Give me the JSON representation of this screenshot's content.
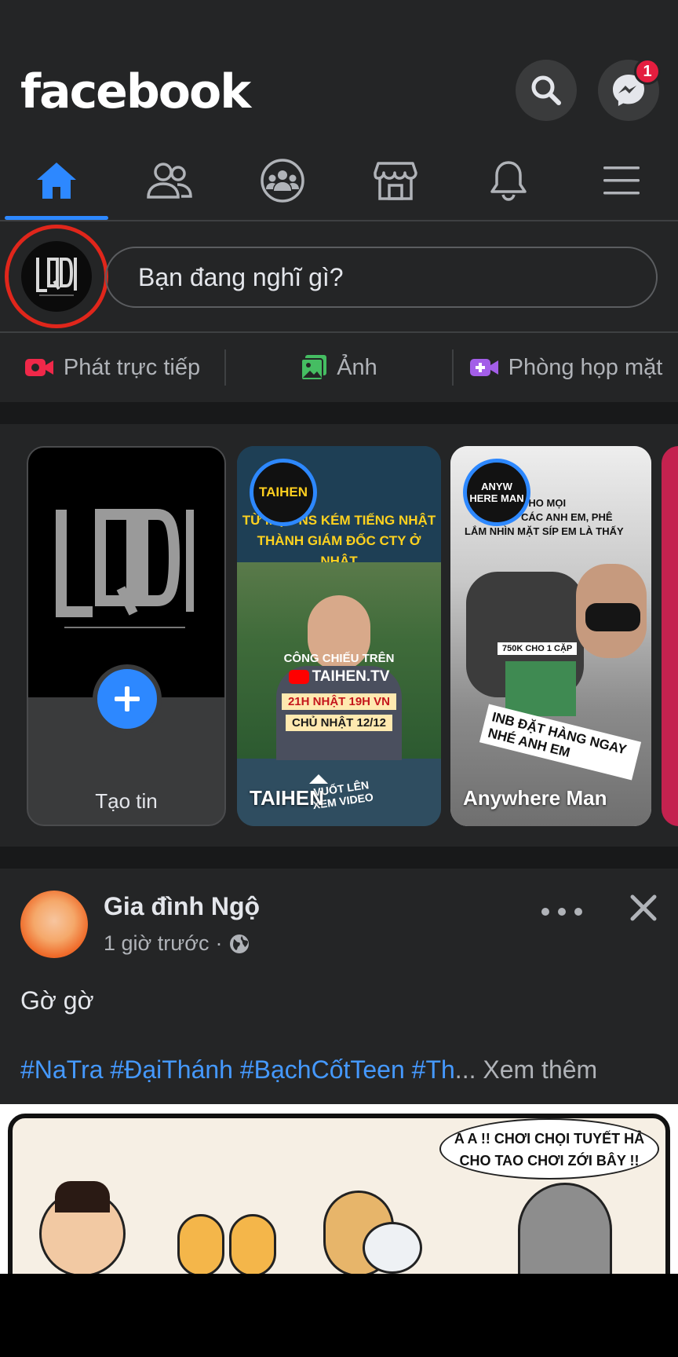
{
  "header": {
    "logo": "facebook",
    "search_icon": "search-icon",
    "messenger_icon": "messenger-icon",
    "messenger_badge": "1"
  },
  "tabs": [
    {
      "name": "home",
      "icon": "home-icon",
      "active": true
    },
    {
      "name": "friends",
      "icon": "friends-icon"
    },
    {
      "name": "groups",
      "icon": "groups-icon"
    },
    {
      "name": "marketplace",
      "icon": "store-icon"
    },
    {
      "name": "notifications",
      "icon": "bell-icon"
    },
    {
      "name": "menu",
      "icon": "menu-icon"
    }
  ],
  "composer": {
    "avatar_text": "LQD",
    "placeholder": "Bạn đang nghĩ gì?"
  },
  "actions": {
    "live": "Phát trực tiếp",
    "photo": "Ảnh",
    "room": "Phòng họp mặt"
  },
  "stories": {
    "create_label": "Tạo tin",
    "items": [
      {
        "name": "TAIHEN",
        "ring_text": "TAIHEN",
        "headline_1": "TỪ MỘT NS KÉM TIẾNG NHẬT",
        "headline_2": "THÀNH GIÁM ĐỐC CTY Ở NHẬT",
        "show_1": "CÔNG CHIẾU TRÊN",
        "show_2": "TAIHEN.TV",
        "show_3": "21H NHẬT 19H VN",
        "show_4": "CHỦ NHẬT 12/12",
        "swipe": "VUỐT LÊN XEM VIDEO"
      },
      {
        "name": "Anywhere Man",
        "ring_text": "ANYW HERE MAN",
        "caption_1": "CHO MỌI",
        "caption_2": "CÁC ANH EM, PHÊ",
        "caption_3": "LẮM NHÌN MẶT SÍP EM LÀ THẤY",
        "price": "750K CHO 1 CẶP",
        "tag": "INB ĐẶT HÀNG NGAY NHÉ ANH EM"
      }
    ]
  },
  "post": {
    "author": "Gia đình Ngộ",
    "time": "1 giờ trước",
    "separator": "·",
    "text": "Gờ gờ",
    "hashtags": [
      "#NaTra",
      "#ĐạiThánh",
      "#BạchCốtTeen",
      "#Th"
    ],
    "ellipsis": "...",
    "see_more": "Xem thêm",
    "image_speech_1": "A A !! CHƠI CHỌI TUYẾT HẢ",
    "image_speech_2": "CHO TAO CHƠI ZỚI BÂY !!"
  }
}
